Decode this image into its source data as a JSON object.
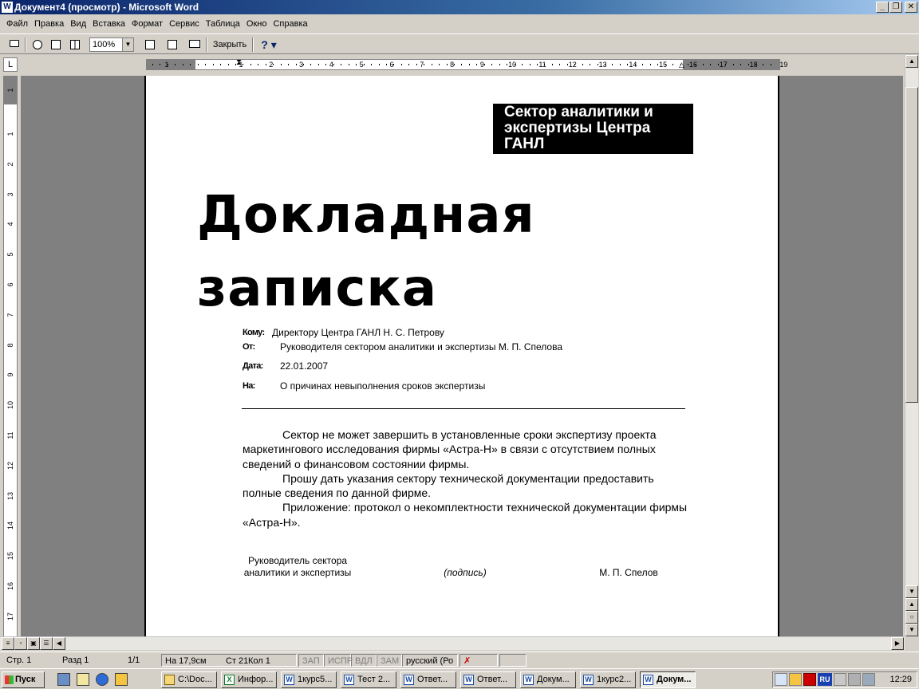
{
  "window": {
    "title": "Документ4 (просмотр) - Microsoft Word",
    "icon": "word-icon",
    "controls": [
      "_",
      "❐",
      "✕"
    ]
  },
  "menu": [
    "Файл",
    "Правка",
    "Вид",
    "Вставка",
    "Формат",
    "Сервис",
    "Таблица",
    "Окно",
    "Справка"
  ],
  "toolbar": {
    "zoom": "100%",
    "close_label": "Закрыть",
    "help_glyph": "?"
  },
  "ruler": {
    "corner": "L",
    "h_numbers": [
      "1",
      "1",
      "2",
      "3",
      "4",
      "5",
      "6",
      "7",
      "8",
      "9",
      "10",
      "11",
      "12",
      "13",
      "14",
      "15",
      "16",
      "17",
      "18",
      "19"
    ],
    "v_numbers": [
      "1",
      "1",
      "2",
      "3",
      "4",
      "5",
      "6",
      "7",
      "8",
      "9",
      "10",
      "11",
      "12",
      "13",
      "14",
      "15",
      "16",
      "17"
    ]
  },
  "document": {
    "banner": "Сектор аналитики и экспертизы Центра ГАНЛ",
    "title_line1": "Докладная",
    "title_line2": "записка",
    "to_label": "Кому:",
    "to_value": "Директору Центра ГАНЛ Н. С. Петрову",
    "from_label": "От:",
    "from_value": "Руководителя сектором аналитики и экспертизы М. П. Спелова",
    "date_label": "Дата:",
    "date_value": "22.01.2007",
    "subject_label": "На:",
    "subject_value": "О причинах невыполнения сроков экспертизы",
    "paragraph1": "Сектор не может завершить в установленные сроки экспертизу проекта маркетингового исследования фирмы «Астра-Н» в связи с отсутствием полных сведений о финансовом состоянии фирмы.",
    "paragraph2": "Прошу дать указания сектору технической документации предоставить полные сведения по данной фирме.",
    "paragraph3": "Приложение: протокол о некомплектности технической документации фирмы «Астра-Н».",
    "sig_position": "Руководитель сектора аналитики и экспертизы",
    "sig_signature": "(подпись)",
    "sig_name": "М. П. Спелов"
  },
  "status": {
    "page": "Стр. 1",
    "section": "Разд 1",
    "pages": "1/1",
    "position": "На 17,9см",
    "line": "Ст 21",
    "column": "Кол 1",
    "rec": "ЗАП",
    "trk": "ИСПР",
    "ext": "ВДЛ",
    "ovr": "ЗАМ",
    "language": "русский (Ро"
  },
  "taskbar": {
    "start": "Пуск",
    "tasks": [
      "C:\\Doc...",
      "Инфор...",
      "1курс5...",
      "Тест 2...",
      "Ответ...",
      "Ответ...",
      "Докум...",
      "1курс2...",
      "Докум..."
    ],
    "lang": "RU",
    "clock": "12:29"
  }
}
